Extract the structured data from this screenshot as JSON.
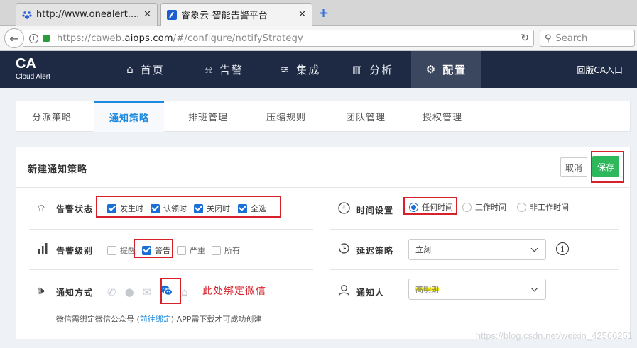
{
  "browser": {
    "tabs": [
      {
        "title": "http://www.onealert....",
        "close": "✕"
      },
      {
        "title": "睿象云-智能告警平台",
        "close": "✕"
      }
    ],
    "new_tab": "+",
    "url_prefix": "https://caweb.",
    "url_domain": "aiops.com",
    "url_path": "/#/configure/notifyStrategy",
    "search_placeholder": "Search"
  },
  "header": {
    "logo_big": "CA",
    "logo_small": "Cloud Alert",
    "menu": [
      {
        "label": "首页",
        "icon": "home-icon"
      },
      {
        "label": "告警",
        "icon": "alarm-light-icon"
      },
      {
        "label": "集成",
        "icon": "layers-icon"
      },
      {
        "label": "分析",
        "icon": "bar-chart-icon"
      },
      {
        "label": "配置",
        "icon": "gears-icon"
      }
    ],
    "old_version": "回版CA入口"
  },
  "subtabs": [
    "分派策略",
    "通知策略",
    "排班管理",
    "压缩规则",
    "团队管理",
    "授权管理"
  ],
  "card": {
    "title": "新建通知策略",
    "cancel": "取消",
    "save": "保存",
    "alert_state": {
      "label": "告警状态",
      "options": [
        {
          "label": "发生时",
          "checked": true
        },
        {
          "label": "认领时",
          "checked": true
        },
        {
          "label": "关闭时",
          "checked": true
        },
        {
          "label": "全选",
          "checked": true
        }
      ]
    },
    "alert_level": {
      "label": "告警级别",
      "options": [
        {
          "label": "提醒",
          "checked": false
        },
        {
          "label": "警告",
          "checked": true
        },
        {
          "label": "严重",
          "checked": false
        },
        {
          "label": "所有",
          "checked": false
        }
      ]
    },
    "notify_method": {
      "label": "通知方式",
      "annotation": "此处绑定微信",
      "hint_prefix": "微信需绑定微信公众号 (",
      "hint_link": "前往绑定",
      "hint_suffix": ") APP需下载才可成功创建"
    },
    "time_setting": {
      "label": "时间设置",
      "options": [
        {
          "label": "任何时间",
          "selected": true
        },
        {
          "label": "工作时间",
          "selected": false
        },
        {
          "label": "非工作时间",
          "selected": false
        }
      ]
    },
    "delay_strategy": {
      "label": "延迟策略",
      "value": "立刻",
      "info": "i"
    },
    "notify_person": {
      "label": "通知人",
      "value": "高明朗"
    }
  },
  "watermark": "https://blog.csdn.net/weixin_42566251"
}
